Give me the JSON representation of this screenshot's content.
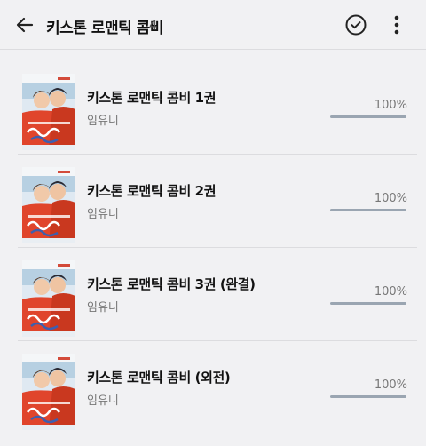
{
  "header": {
    "title": "키스톤 로맨틱 콤비",
    "count": "4",
    "back_icon": "arrow-left-icon",
    "check_icon": "check-circle-icon",
    "more_icon": "more-vertical-icon"
  },
  "books": [
    {
      "title": "키스톤 로맨틱 콤비 1권",
      "author": "임유니",
      "progress_label": "100%",
      "progress": 1.0
    },
    {
      "title": "키스톤 로맨틱 콤비 2권",
      "author": "임유니",
      "progress_label": "100%",
      "progress": 1.0
    },
    {
      "title": "키스톤 로맨틱 콤비 3권 (완결)",
      "author": "임유니",
      "progress_label": "100%",
      "progress": 1.0
    },
    {
      "title": "키스톤 로맨틱 콤비 (외전)",
      "author": "임유니",
      "progress_label": "100%",
      "progress": 1.0
    }
  ],
  "colors": {
    "background": "#f1f1f3",
    "progress_fill": "#9aa5b1",
    "progress_track": "#d7dbe0",
    "cover_shirt": "#e0452c"
  }
}
